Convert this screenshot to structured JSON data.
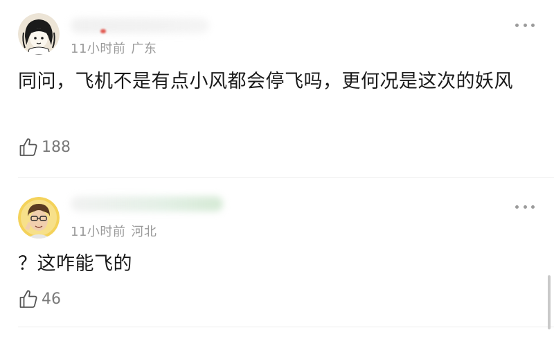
{
  "comments": [
    {
      "meta": {
        "time": "11小时前",
        "location": "广东"
      },
      "text": "同问，飞机不是有点小风都会停飞吗，更何况是这次的妖风",
      "likes": "188"
    },
    {
      "meta": {
        "time": "11小时前",
        "location": "河北"
      },
      "text": "？这咋能飞的",
      "likes": "46"
    }
  ],
  "colors": {
    "text": "#1a1a1a",
    "meta": "#9a9a9a",
    "like": "#7a7a7a",
    "divider": "#ececec",
    "icon": "#9b9b9b"
  },
  "icons": {
    "more": "more-icon",
    "like": "thumbs-up-icon"
  }
}
